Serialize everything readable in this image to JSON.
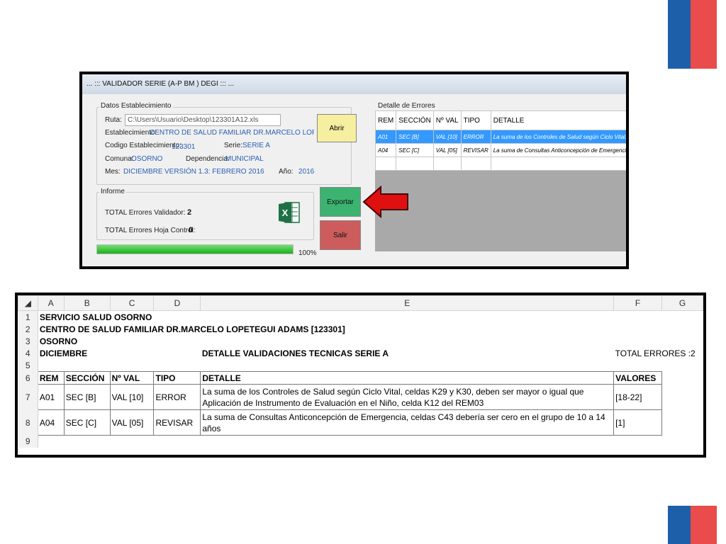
{
  "colors": {
    "flag_blue": "#1d5fa8",
    "flag_red": "#ea4b4b",
    "accent_value": "#2a5fb4",
    "abrir_button": "#f7efa0",
    "exportar_button": "#3cb371",
    "salir_button": "#cd5c5c",
    "progress": "#2ec12e",
    "arrow": "#e01010"
  },
  "window": {
    "title": "... ::: VALIDADOR SERIE (A-P BM ) DEGI ::: ...",
    "datos": {
      "legend": "Datos Establecimiento",
      "ruta_label": "Ruta:",
      "ruta_value": "C:\\Users\\Usuario\\Desktop\\123301A12.xls",
      "establecimiento_label": "Establecimiento:",
      "establecimiento_value": "CENTRO DE SALUD FAMILIAR DR.MARCELO LOPETEGUI A",
      "codigo_label": "Codigo Establecimiento:",
      "codigo_value": "123301",
      "serie_label": "Serie:",
      "serie_value": "SERIE A",
      "comuna_label": "Comuna:",
      "comuna_value": "OSORNO",
      "dependencia_label": "Dependencia:",
      "dependencia_value": "MUNICIPAL",
      "mes_label": "Mes:",
      "mes_value": "DICIEMBRE",
      "version_value": "VERSIÓN 1.3: FEBRERO 2016",
      "anio_label": "Año:",
      "anio_value": "2016",
      "abrir_label": "Abrir"
    },
    "informe": {
      "legend": "Informe",
      "total_validador_label": "TOTAL Errores Validador:",
      "total_validador_value": "2",
      "total_hoja_label": "TOTAL Errores Hoja Control:",
      "total_hoja_value": "0",
      "excel_icon": "excel-icon"
    },
    "exportar_label": "Exportar",
    "salir_label": "Salir",
    "progress": {
      "value": 1.0,
      "text": "100%"
    },
    "detalle": {
      "legend": "Detalle de Errores",
      "columns": [
        "REM",
        "SECCIÓN",
        "Nº VAL",
        "TIPO",
        "DETALLE"
      ],
      "rows": [
        [
          "A01",
          "SEC [B]",
          "VAL [10]",
          "ERROR",
          "La suma de los Controles de Salud según Ciclo Vital, celdas"
        ],
        [
          "A04",
          "SEC [C]",
          "VAL [05]",
          "REVISAR",
          "La suma de Consultas Anticoncepción de Emergencia"
        ]
      ]
    }
  },
  "excel": {
    "columns": [
      "A",
      "B",
      "C",
      "D",
      "E",
      "F",
      "G"
    ],
    "row_numbers": [
      "1",
      "2",
      "3",
      "4",
      "5",
      "6",
      "7",
      "8",
      "9"
    ],
    "line1": "SERVICIO SALUD OSORNO",
    "line2": "CENTRO DE SALUD FAMILIAR DR.MARCELO LOPETEGUI ADAMS [123301]",
    "line3": "OSORNO",
    "line4": "DICIEMBRE",
    "detalle_title": "DETALLE VALIDACIONES TECNICAS SERIE A",
    "total_errores": "TOTAL ERRORES :2",
    "headers": [
      "REM",
      "SECCIÓN",
      "Nº VAL",
      "TIPO",
      "DETALLE",
      "VALORES"
    ],
    "rows": [
      [
        "A01",
        "SEC [B]",
        "VAL [10]",
        "ERROR",
        "La suma de los Controles de Salud según Ciclo Vital, celdas K29 y K30, deben ser mayor o igual que Aplicación de Instrumento de Evaluación en el Niño, celda K12 del REM03",
        "[18-22]"
      ],
      [
        "A04",
        "SEC [C]",
        "VAL [05]",
        "REVISAR",
        "La suma de Consultas Anticoncepción de Emergencia, celdas C43 debería ser cero en el grupo de 10 a 14 años",
        "[1]"
      ]
    ]
  }
}
